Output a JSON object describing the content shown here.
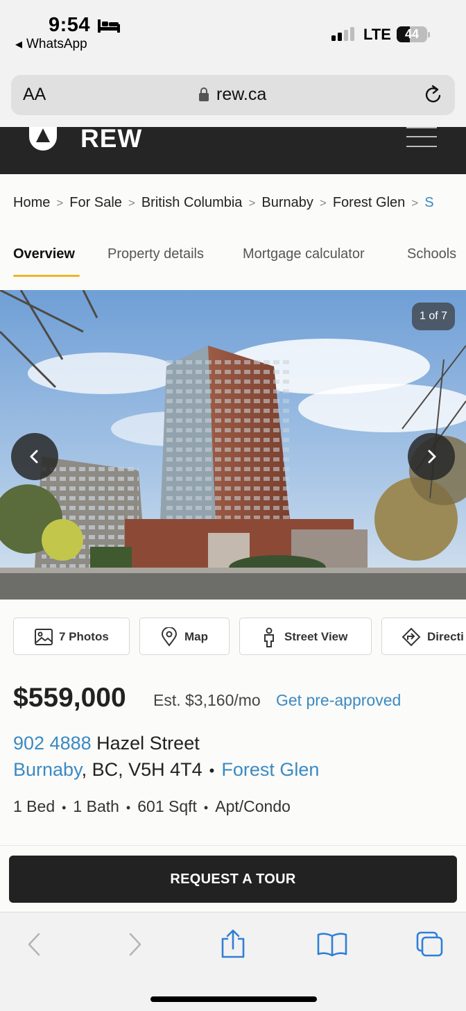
{
  "status_bar": {
    "time": "9:54",
    "back_app": "WhatsApp",
    "network": "LTE",
    "battery": "44",
    "battery_level": 0.44
  },
  "browser": {
    "text_size_label": "AA",
    "url": "rew.ca"
  },
  "site_header": {
    "logo_text": "REW"
  },
  "breadcrumb": [
    "Home",
    "For Sale",
    "British Columbia",
    "Burnaby",
    "Forest Glen"
  ],
  "breadcrumb_more": "S",
  "tabs": [
    "Overview",
    "Property details",
    "Mortgage calculator",
    "Schools"
  ],
  "active_tab": "Overview",
  "gallery": {
    "counter": "1 of 7"
  },
  "actions": {
    "photos": "7 Photos",
    "map": "Map",
    "street_view": "Street View",
    "directions": "Directi"
  },
  "listing": {
    "price": "$559,000",
    "est_payment": "Est. $3,160/mo",
    "preapproved_link": "Get pre-approved",
    "unit_number": "902 4888",
    "street": "Hazel Street",
    "city": "Burnaby",
    "province_postal": ", BC, V5H 4T4",
    "neighbourhood": "Forest Glen",
    "beds": "1 Bed",
    "baths": "1 Bath",
    "sqft": "601 Sqft",
    "type": "Apt/Condo"
  },
  "cta": {
    "tour": "REQUEST A TOUR"
  },
  "colors": {
    "accent_link": "#3a8ac4",
    "tab_underline": "#f0b429",
    "header_bg": "#252525"
  }
}
